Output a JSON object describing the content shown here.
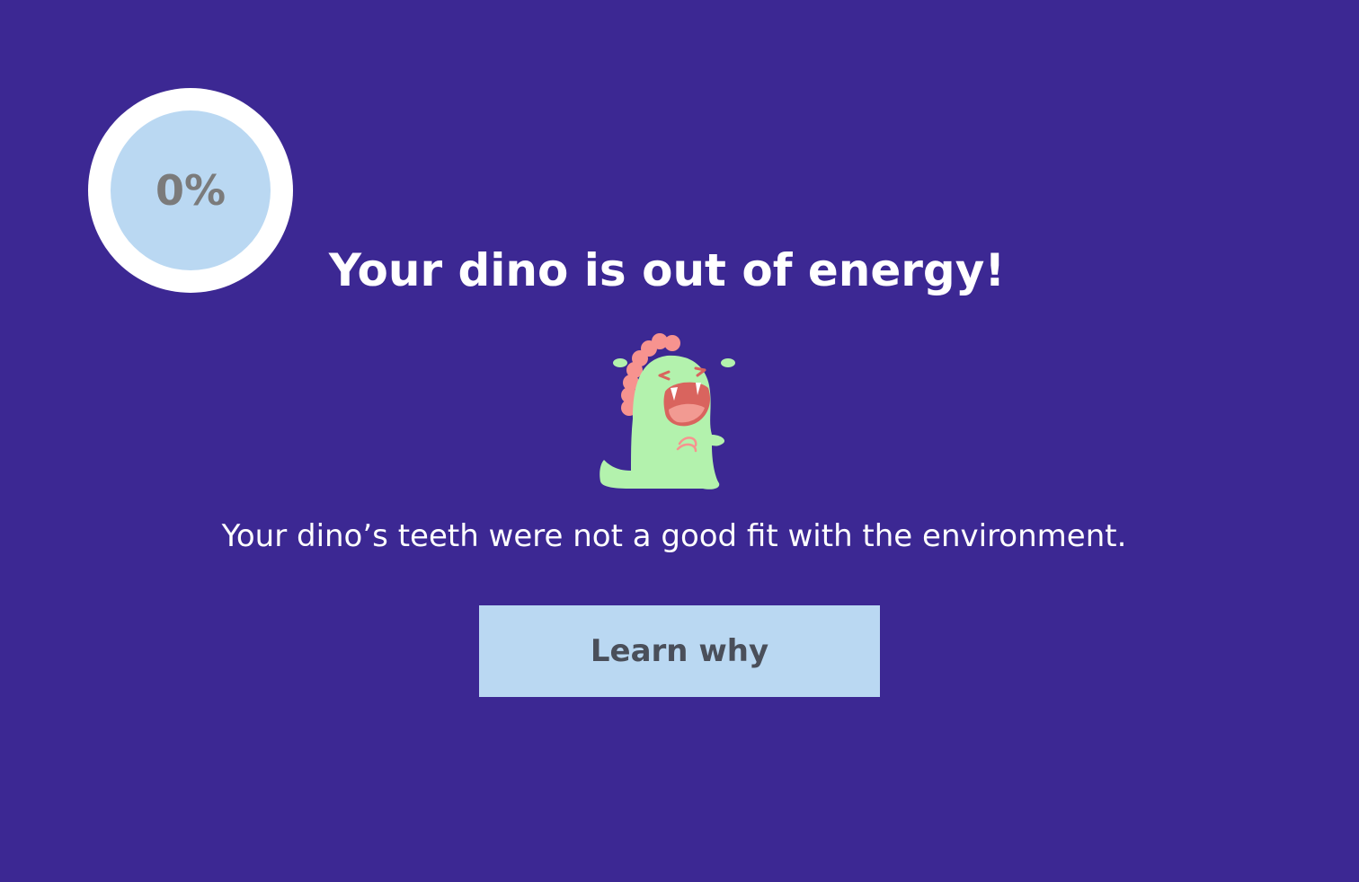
{
  "colors": {
    "background": "#3c2893",
    "meter_ring": "#ffffff",
    "meter_fill": "#bad8f2",
    "meter_text": "#7b7b7b",
    "title_text": "#ffffff",
    "message_text": "#ffffff",
    "button_bg": "#bad8f2",
    "button_text": "#4a4f5a",
    "dino_body": "#b3f2ad",
    "dino_spikes": "#f7938f",
    "dino_mouth": "#d9645e"
  },
  "energy": {
    "label": "0%",
    "value": 0
  },
  "title": "Your dino is out of energy!",
  "dino": {
    "icon": "crying-dino-icon"
  },
  "message": "Your dino’s teeth were not a good fit with the environment.",
  "button": {
    "label": "Learn why"
  }
}
